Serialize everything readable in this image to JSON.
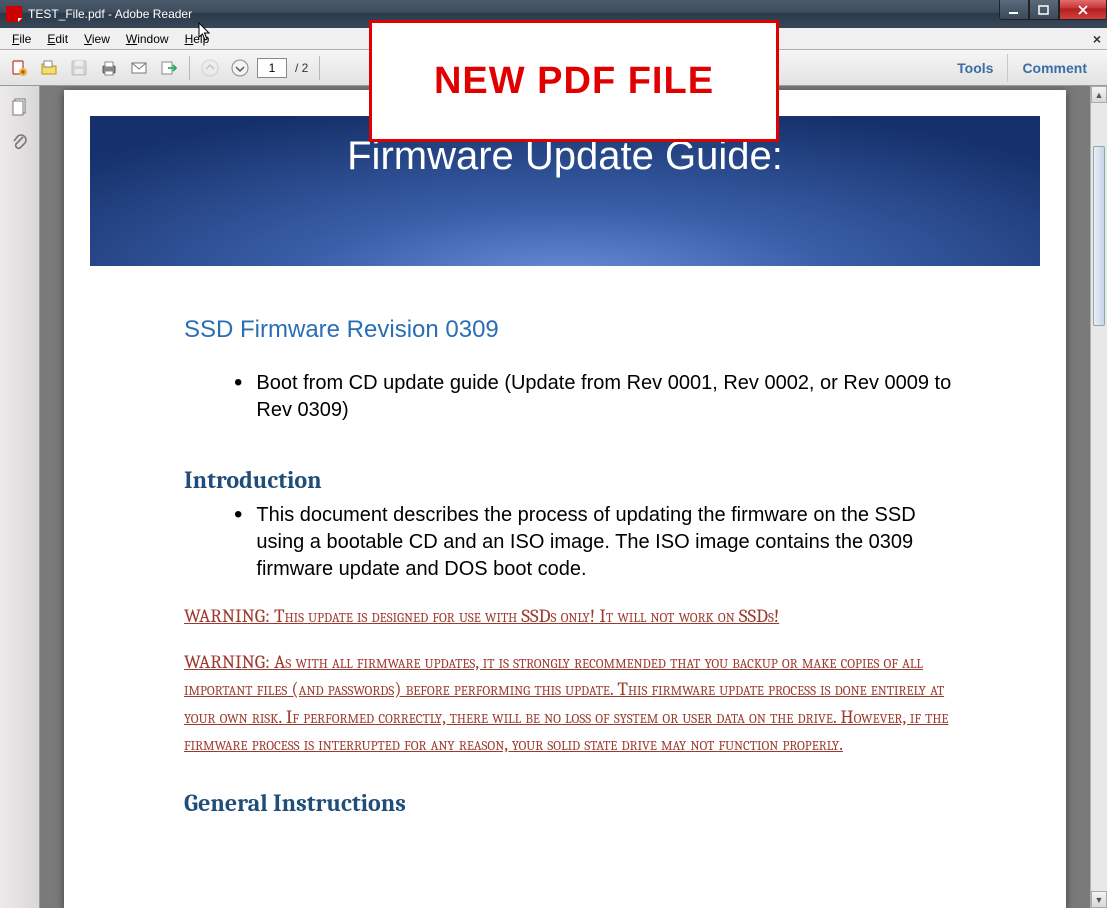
{
  "window": {
    "title": "TEST_File.pdf - Adobe Reader"
  },
  "menu": {
    "items": [
      "File",
      "Edit",
      "View",
      "Window",
      "Help"
    ]
  },
  "toolbar": {
    "page_current": "1",
    "page_total": "/ 2",
    "tools_label": "Tools",
    "comment_label": "Comment"
  },
  "overlay": {
    "text": "NEW PDF FILE"
  },
  "document": {
    "banner_title": "Firmware Update Guide:",
    "revision_heading": "SSD Firmware Revision 0309",
    "revision_bullet": "Boot from CD update guide (Update from Rev 0001, Rev 0002, or Rev 0009 to Rev 0309)",
    "intro_heading": "Introduction",
    "intro_bullet": "This document describes the process of updating the firmware on the SSD using a bootable CD and an ISO image. The ISO image contains the 0309 firmware update and DOS boot code.",
    "warning1": "WARNING: This update is designed for use with SSDs only! It will not work on SSDs!",
    "warning2": "WARNING: As with all firmware updates, it is strongly recommended that you backup or make copies of all important files (and passwords) before performing this update. This firmware update process is done entirely at your own risk. If performed correctly, there will be no loss of system or user data on the drive. However, if the firmware process is interrupted for any reason, your solid state drive may not function properly.",
    "general_heading": "General Instructions"
  }
}
